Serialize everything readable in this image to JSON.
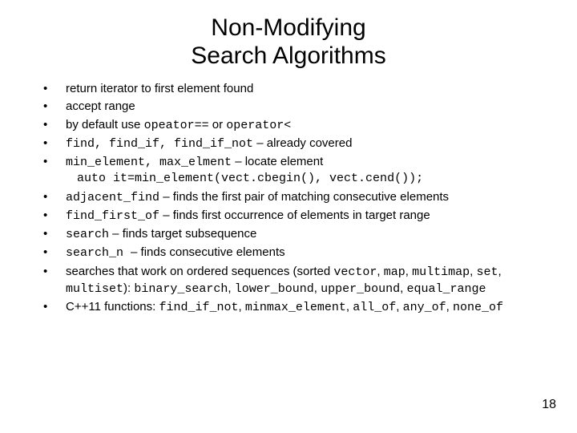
{
  "title_line1": "Non-Modifying",
  "title_line2": "Search Algorithms",
  "b1": "return iterator to first element found",
  "b2": "accept range",
  "b3_pre": "by default use ",
  "b3_c1": "opeator==",
  "b3_mid": " or ",
  "b3_c2": "operator<",
  "b4_c": "find, find_if, find_if_not",
  "b4_post": " – already covered",
  "b5_c": "min_element, max_elment",
  "b5_post": " – locate element",
  "b5_sub": "auto it=min_element(vect.cbegin(), vect.cend());",
  "b6_c": "adjacent_find",
  "b6_post": " – finds the first pair of matching consecutive elements",
  "b7_c": "find_first_of",
  "b7_post": " – finds first occurrence of elements in target range",
  "b8_c": "search",
  "b8_post": " – finds target subsequence",
  "b9_c": "search_n ",
  "b9_post": " – finds consecutive elements",
  "b10_pre": "searches that work on ordered sequences (sorted ",
  "b10_c1": "vector",
  "b10_s1": ", ",
  "b10_c2": "map",
  "b10_s2": ", ",
  "b10_c3": "multimap",
  "b10_s3": ", ",
  "b10_c4": "set",
  "b10_s4": ", ",
  "b10_c5": "multiset",
  "b10_mid": "): ",
  "b10_c6": "binary_search",
  "b10_s5": ", ",
  "b10_c7": "lower_bound",
  "b10_s6": ", ",
  "b10_c8": "upper_bound",
  "b10_s7": ", ",
  "b10_c9": "equal_range",
  "b11_pre": "C++11 functions: ",
  "b11_c1": "find_if_not",
  "b11_s1": ", ",
  "b11_c2": "minmax_element",
  "b11_s2": ", ",
  "b11_c3": "all_of",
  "b11_s3": ", ",
  "b11_c4": "any_of",
  "b11_s4": ", ",
  "b11_c5": "none_of",
  "page_number": "18"
}
